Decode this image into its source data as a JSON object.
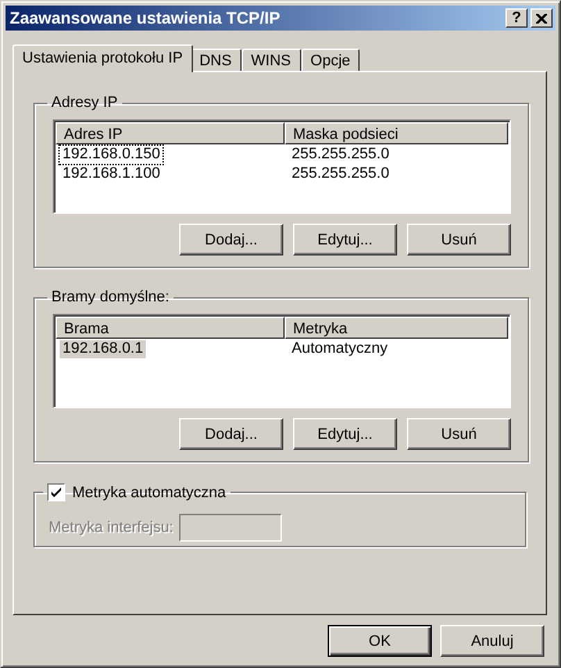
{
  "window": {
    "title": "Zaawansowane ustawienia TCP/IP",
    "help_button": "?"
  },
  "tabs": [
    {
      "label": "Ustawienia protokołu IP",
      "selected": true
    },
    {
      "label": "DNS",
      "selected": false
    },
    {
      "label": "WINS",
      "selected": false
    },
    {
      "label": "Opcje",
      "selected": false
    }
  ],
  "ip_addresses": {
    "title": "Adresy IP",
    "columns": [
      "Adres IP",
      "Maska podsieci"
    ],
    "rows": [
      {
        "cells": [
          "192.168.0.150",
          "255.255.255.0"
        ],
        "selected": false,
        "focused": true
      },
      {
        "cells": [
          "192.168.1.100",
          "255.255.255.0"
        ],
        "selected": false,
        "focused": false
      }
    ],
    "buttons": [
      "Dodaj...",
      "Edytuj...",
      "Usuń"
    ]
  },
  "gateways": {
    "title": "Bramy domyślne:",
    "columns": [
      "Brama",
      "Metryka"
    ],
    "rows": [
      {
        "cells": [
          "192.168.0.1",
          "Automatyczny"
        ],
        "selected": true,
        "focused": false
      }
    ],
    "buttons": [
      "Dodaj...",
      "Edytuj...",
      "Usuń"
    ]
  },
  "metric": {
    "checkbox_label": "Metryka automatyczna",
    "checked": true,
    "field_label": "Metryka interfejsu:"
  },
  "buttons": [
    "OK",
    "Anuluj"
  ]
}
